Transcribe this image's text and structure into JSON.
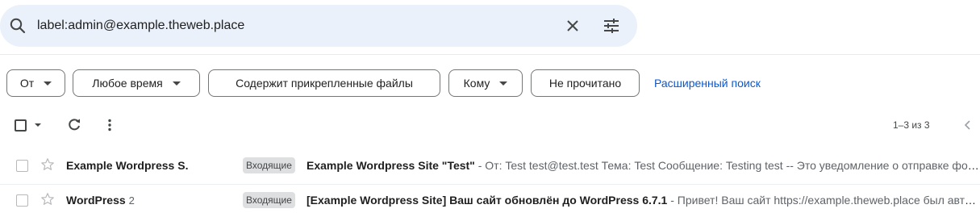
{
  "search": {
    "query": "label:admin@example.theweb.place"
  },
  "filters": {
    "from": "От",
    "any_time": "Любое время",
    "has_attachments": "Содержит прикрепленные файлы",
    "to": "Кому",
    "unread": "Не прочитано",
    "advanced_search": "Расширенный поиск"
  },
  "toolbar": {
    "pagination": "1–3 из 3"
  },
  "emails": [
    {
      "sender": "Example Wordpress S.",
      "count": "",
      "label": "Входящие",
      "subject": "Example Wordpress Site \"Test\"",
      "snippet": " - От: Test test@test.test Тема: Test Сообщение: Testing test -- Это уведомление о отправке формы обратной связи"
    },
    {
      "sender": "WordPress",
      "count": "2",
      "label": "Входящие",
      "subject": "[Example Wordpress Site] Ваш сайт обновлён до WordPress 6.7.1",
      "snippet": " - Привет! Ваш сайт https://example.theweb.place был автоматически обновлён"
    }
  ],
  "colors": {
    "search_bg": "#eaf1fb",
    "link": "#0b57d0",
    "label_chip_bg": "#dddfe1"
  },
  "icons": [
    "search-icon",
    "clear-icon",
    "search-options-icon",
    "dropdown-caret-icon",
    "refresh-icon",
    "more-vert-icon",
    "chevron-left-icon",
    "star-icon"
  ]
}
